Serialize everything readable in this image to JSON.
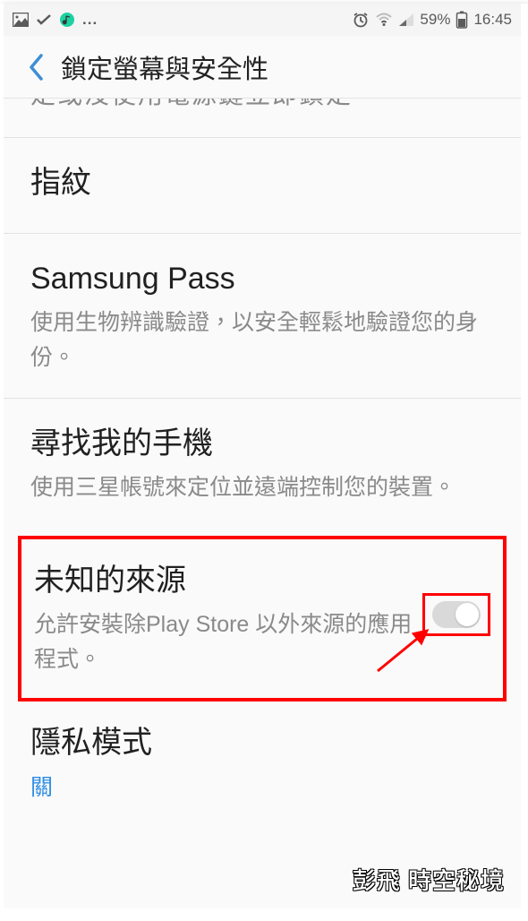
{
  "status": {
    "battery_text": "59%",
    "time": "16:45"
  },
  "header": {
    "title": "鎖定螢幕與安全性"
  },
  "partial_row_text": "定或沒使用電源鍵立即鎖定",
  "rows": {
    "fingerprint": {
      "title": "指紋"
    },
    "samsung_pass": {
      "title": "Samsung Pass",
      "sub": "使用生物辨識驗證，以安全輕鬆地驗證您的身份。"
    },
    "find_phone": {
      "title": "尋找我的手機",
      "sub": "使用三星帳號來定位並遠端控制您的裝置。"
    },
    "unknown_sources": {
      "title": "未知的來源",
      "sub": "允許安裝除Play Store 以外來源的應用程式。"
    },
    "private_mode": {
      "title": "隱私模式",
      "status": "關"
    }
  },
  "watermark": "彭飛  時空秘境"
}
